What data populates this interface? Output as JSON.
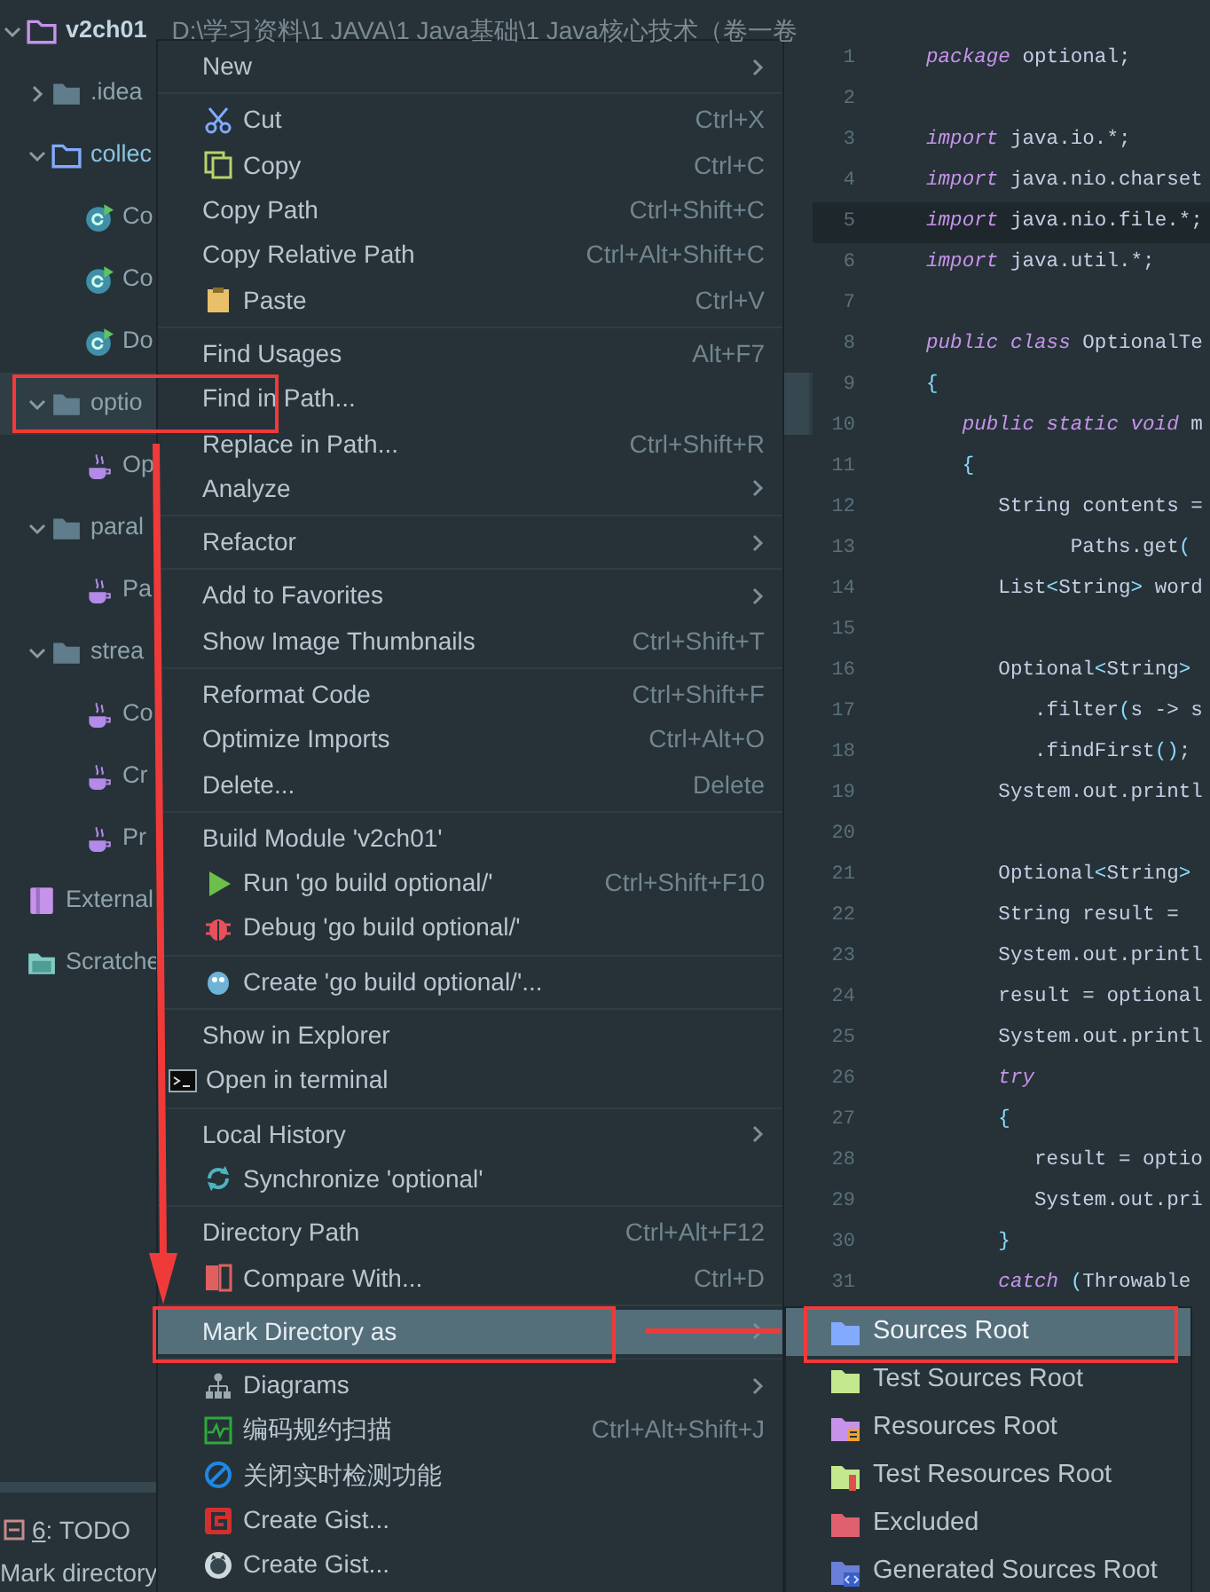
{
  "tree": [
    {
      "label": "v2ch01",
      "kind": "project",
      "path": "D:\\学习资料\\1 JAVA\\1 Java基础\\1 Java核心技术（卷一卷",
      "expanded": true,
      "selected": false,
      "children": [
        {
          "label": ".idea",
          "kind": "folder",
          "expanded": false,
          "selected": false
        },
        {
          "label": "collec",
          "kind": "source-folder",
          "expanded": true,
          "selected": false,
          "children": [
            {
              "label": "Co",
              "kind": "class",
              "selected": false
            },
            {
              "label": "Co",
              "kind": "class",
              "selected": false
            },
            {
              "label": "Do",
              "kind": "class",
              "selected": false
            }
          ]
        },
        {
          "label": "optio",
          "kind": "folder",
          "expanded": true,
          "selected": true,
          "children": [
            {
              "label": "Op",
              "kind": "java-file",
              "selected": false
            }
          ]
        },
        {
          "label": "paral",
          "kind": "folder",
          "expanded": true,
          "selected": false,
          "children": [
            {
              "label": "Pa",
              "kind": "java-file",
              "selected": false
            }
          ]
        },
        {
          "label": "strea",
          "kind": "folder",
          "expanded": true,
          "selected": false,
          "children": [
            {
              "label": "Co",
              "kind": "java-file",
              "selected": false
            },
            {
              "label": "Cr",
              "kind": "java-file",
              "selected": false
            },
            {
              "label": "Pr",
              "kind": "java-file",
              "selected": false
            }
          ]
        }
      ]
    },
    {
      "label": "External",
      "kind": "library",
      "selected": false
    },
    {
      "label": "Scratche",
      "kind": "scratches",
      "selected": false
    }
  ],
  "tool_window": {
    "number": "6",
    "label": ": TODO"
  },
  "status_bar": "Mark directory",
  "code": [
    {
      "number": "1",
      "current": false,
      "segments": [
        {
          "kind": "keyword",
          "text": "package"
        },
        {
          "kind": "plain",
          "text": " optional;"
        }
      ]
    },
    {
      "number": "2",
      "current": false
    },
    {
      "number": "3",
      "current": false,
      "segments": [
        {
          "kind": "keyword",
          "text": "import"
        },
        {
          "kind": "plain",
          "text": " java.io.*;"
        }
      ]
    },
    {
      "number": "4",
      "current": false,
      "segments": [
        {
          "kind": "keyword",
          "text": "import"
        },
        {
          "kind": "plain",
          "text": " java.nio.charset"
        }
      ]
    },
    {
      "number": "5",
      "current": true,
      "segments": [
        {
          "kind": "keyword",
          "text": "import"
        },
        {
          "kind": "plain",
          "text": " java.nio.file.*;"
        }
      ]
    },
    {
      "number": "6",
      "current": false,
      "segments": [
        {
          "kind": "keyword",
          "text": "import"
        },
        {
          "kind": "plain",
          "text": " java.util.*;"
        }
      ]
    },
    {
      "number": "7",
      "current": false
    },
    {
      "number": "8",
      "current": false,
      "segments": [
        {
          "kind": "keyword",
          "text": "public class"
        },
        {
          "kind": "plain",
          "text": " OptionalTe"
        }
      ]
    },
    {
      "number": "9",
      "current": false,
      "segments": [
        {
          "kind": "punct",
          "text": "{"
        }
      ]
    },
    {
      "number": "10",
      "current": false,
      "segments": [
        {
          "kind": "keyword",
          "text": "   public static void"
        },
        {
          "kind": "plain",
          "text": " m"
        }
      ]
    },
    {
      "number": "11",
      "current": false,
      "segments": [
        {
          "kind": "punct",
          "text": "   {"
        }
      ]
    },
    {
      "number": "12",
      "current": false,
      "segments": [
        {
          "kind": "plain",
          "text": "      String contents ="
        }
      ]
    },
    {
      "number": "13",
      "current": false,
      "segments": [
        {
          "kind": "plain",
          "text": "            Paths.get"
        },
        {
          "kind": "punct",
          "text": "("
        }
      ]
    },
    {
      "number": "14",
      "current": false,
      "segments": [
        {
          "kind": "plain",
          "text": "      List"
        },
        {
          "kind": "punct",
          "text": "<"
        },
        {
          "kind": "plain",
          "text": "String"
        },
        {
          "kind": "punct",
          "text": ">"
        },
        {
          "kind": "plain",
          "text": " word"
        }
      ]
    },
    {
      "number": "15",
      "current": false
    },
    {
      "number": "16",
      "current": false,
      "segments": [
        {
          "kind": "plain",
          "text": "      Optional"
        },
        {
          "kind": "punct",
          "text": "<"
        },
        {
          "kind": "plain",
          "text": "String"
        },
        {
          "kind": "punct",
          "text": ">"
        }
      ]
    },
    {
      "number": "17",
      "current": false,
      "segments": [
        {
          "kind": "plain",
          "text": "         .filter"
        },
        {
          "kind": "punct",
          "text": "("
        },
        {
          "kind": "plain",
          "text": "s -> s"
        }
      ]
    },
    {
      "number": "18",
      "current": false,
      "segments": [
        {
          "kind": "plain",
          "text": "         .findFirst"
        },
        {
          "kind": "punct",
          "text": "()"
        },
        {
          "kind": "plain",
          "text": ";"
        }
      ]
    },
    {
      "number": "19",
      "current": false,
      "segments": [
        {
          "kind": "plain",
          "text": "      System.out.printl"
        }
      ]
    },
    {
      "number": "20",
      "current": false
    },
    {
      "number": "21",
      "current": false,
      "segments": [
        {
          "kind": "plain",
          "text": "      Optional"
        },
        {
          "kind": "punct",
          "text": "<"
        },
        {
          "kind": "plain",
          "text": "String"
        },
        {
          "kind": "punct",
          "text": ">"
        }
      ]
    },
    {
      "number": "22",
      "current": false,
      "segments": [
        {
          "kind": "plain",
          "text": "      String result ="
        }
      ]
    },
    {
      "number": "23",
      "current": false,
      "segments": [
        {
          "kind": "plain",
          "text": "      System.out.printl"
        }
      ]
    },
    {
      "number": "24",
      "current": false,
      "segments": [
        {
          "kind": "plain",
          "text": "      result = optional"
        }
      ]
    },
    {
      "number": "25",
      "current": false,
      "segments": [
        {
          "kind": "plain",
          "text": "      System.out.printl"
        }
      ]
    },
    {
      "number": "26",
      "current": false,
      "segments": [
        {
          "kind": "keyword",
          "text": "      try"
        }
      ]
    },
    {
      "number": "27",
      "current": false,
      "segments": [
        {
          "kind": "punct",
          "text": "      {"
        }
      ]
    },
    {
      "number": "28",
      "current": false,
      "segments": [
        {
          "kind": "plain",
          "text": "         result = optio"
        }
      ]
    },
    {
      "number": "29",
      "current": false,
      "segments": [
        {
          "kind": "plain",
          "text": "         System.out.pri"
        }
      ]
    },
    {
      "number": "30",
      "current": false,
      "segments": [
        {
          "kind": "punct",
          "text": "      }"
        }
      ]
    },
    {
      "number": "31",
      "current": false,
      "segments": [
        {
          "kind": "keyword",
          "text": "      catch"
        },
        {
          "kind": "punct",
          "text": " ("
        },
        {
          "kind": "plain",
          "text": "Throwable"
        }
      ]
    }
  ],
  "context_menu": [
    {
      "kind": "item",
      "label": "New",
      "submenu": true,
      "selected": false
    },
    {
      "kind": "separator"
    },
    {
      "kind": "item",
      "label": "Cut",
      "shortcut": "Ctrl+X",
      "submenu": false,
      "selected": false
    },
    {
      "kind": "item",
      "label": "Copy",
      "shortcut": "Ctrl+C",
      "submenu": false,
      "selected": false
    },
    {
      "kind": "item",
      "label": "Copy Path",
      "shortcut": "Ctrl+Shift+C",
      "submenu": false,
      "selected": false
    },
    {
      "kind": "item",
      "label": "Copy Relative Path",
      "shortcut": "Ctrl+Alt+Shift+C",
      "submenu": false,
      "selected": false
    },
    {
      "kind": "item",
      "label": "Paste",
      "shortcut": "Ctrl+V",
      "submenu": false,
      "selected": false
    },
    {
      "kind": "separator"
    },
    {
      "kind": "item",
      "label": "Find Usages",
      "shortcut": "Alt+F7",
      "submenu": false,
      "selected": false
    },
    {
      "kind": "item",
      "label": "Find in Path...",
      "submenu": false,
      "selected": false
    },
    {
      "kind": "item",
      "label": "Replace in Path...",
      "shortcut": "Ctrl+Shift+R",
      "submenu": false,
      "selected": false
    },
    {
      "kind": "item",
      "label": "Analyze",
      "submenu": true,
      "selected": false
    },
    {
      "kind": "separator"
    },
    {
      "kind": "item",
      "label": "Refactor",
      "submenu": true,
      "selected": false
    },
    {
      "kind": "separator"
    },
    {
      "kind": "item",
      "label": "Add to Favorites",
      "submenu": true,
      "selected": false
    },
    {
      "kind": "item",
      "label": "Show Image Thumbnails",
      "shortcut": "Ctrl+Shift+T",
      "submenu": false,
      "selected": false
    },
    {
      "kind": "separator"
    },
    {
      "kind": "item",
      "label": "Reformat Code",
      "shortcut": "Ctrl+Shift+F",
      "submenu": false,
      "selected": false
    },
    {
      "kind": "item",
      "label": "Optimize Imports",
      "shortcut": "Ctrl+Alt+O",
      "submenu": false,
      "selected": false
    },
    {
      "kind": "item",
      "label": "Delete...",
      "shortcut": "Delete",
      "submenu": false,
      "selected": false
    },
    {
      "kind": "separator"
    },
    {
      "kind": "item",
      "label": "Build Module 'v2ch01'",
      "submenu": false,
      "selected": false
    },
    {
      "kind": "item",
      "label": "Run 'go build optional/'",
      "shortcut": "Ctrl+Shift+F10",
      "submenu": false,
      "selected": false
    },
    {
      "kind": "item",
      "label": "Debug 'go build optional/'",
      "submenu": false,
      "selected": false
    },
    {
      "kind": "separator"
    },
    {
      "kind": "item",
      "label": "Create 'go build optional/'...",
      "submenu": false,
      "selected": false
    },
    {
      "kind": "separator"
    },
    {
      "kind": "item",
      "label": "Show in Explorer",
      "submenu": false,
      "selected": false
    },
    {
      "kind": "item",
      "label": "Open in terminal",
      "submenu": false,
      "selected": false
    },
    {
      "kind": "separator"
    },
    {
      "kind": "item",
      "label": "Local History",
      "submenu": true,
      "selected": false
    },
    {
      "kind": "item",
      "label": "Synchronize 'optional'",
      "submenu": false,
      "selected": false
    },
    {
      "kind": "separator"
    },
    {
      "kind": "item",
      "label": "Directory Path",
      "shortcut": "Ctrl+Alt+F12",
      "submenu": false,
      "selected": false
    },
    {
      "kind": "item",
      "label": "Compare With...",
      "shortcut": "Ctrl+D",
      "submenu": false,
      "selected": false
    },
    {
      "kind": "separator"
    },
    {
      "kind": "item",
      "label": "Mark Directory as",
      "submenu": true,
      "selected": true
    },
    {
      "kind": "separator"
    },
    {
      "kind": "item",
      "label": "Diagrams",
      "submenu": true,
      "selected": false
    },
    {
      "kind": "item",
      "label": "编码规约扫描",
      "shortcut": "Ctrl+Alt+Shift+J",
      "submenu": false,
      "selected": false
    },
    {
      "kind": "item",
      "label": "关闭实时检测功能",
      "submenu": false,
      "selected": false
    },
    {
      "kind": "item",
      "label": "Create Gist...",
      "submenu": false,
      "selected": false
    },
    {
      "kind": "item",
      "label": "Create Gist...",
      "submenu": false,
      "selected": false
    }
  ],
  "submenu": [
    {
      "label": "Sources Root",
      "color": "#82aaff",
      "selected": true
    },
    {
      "label": "Test Sources Root",
      "color": "#c3e88d",
      "selected": false
    },
    {
      "label": "Resources Root",
      "color": "#c792ea",
      "selected": false
    },
    {
      "label": "Test Resources Root",
      "color": "#c3e88d",
      "selected": false
    },
    {
      "label": "Excluded",
      "color": "#e06070",
      "selected": false
    },
    {
      "label": "Generated Sources Root",
      "color": "#6a7fd8",
      "selected": false
    }
  ]
}
